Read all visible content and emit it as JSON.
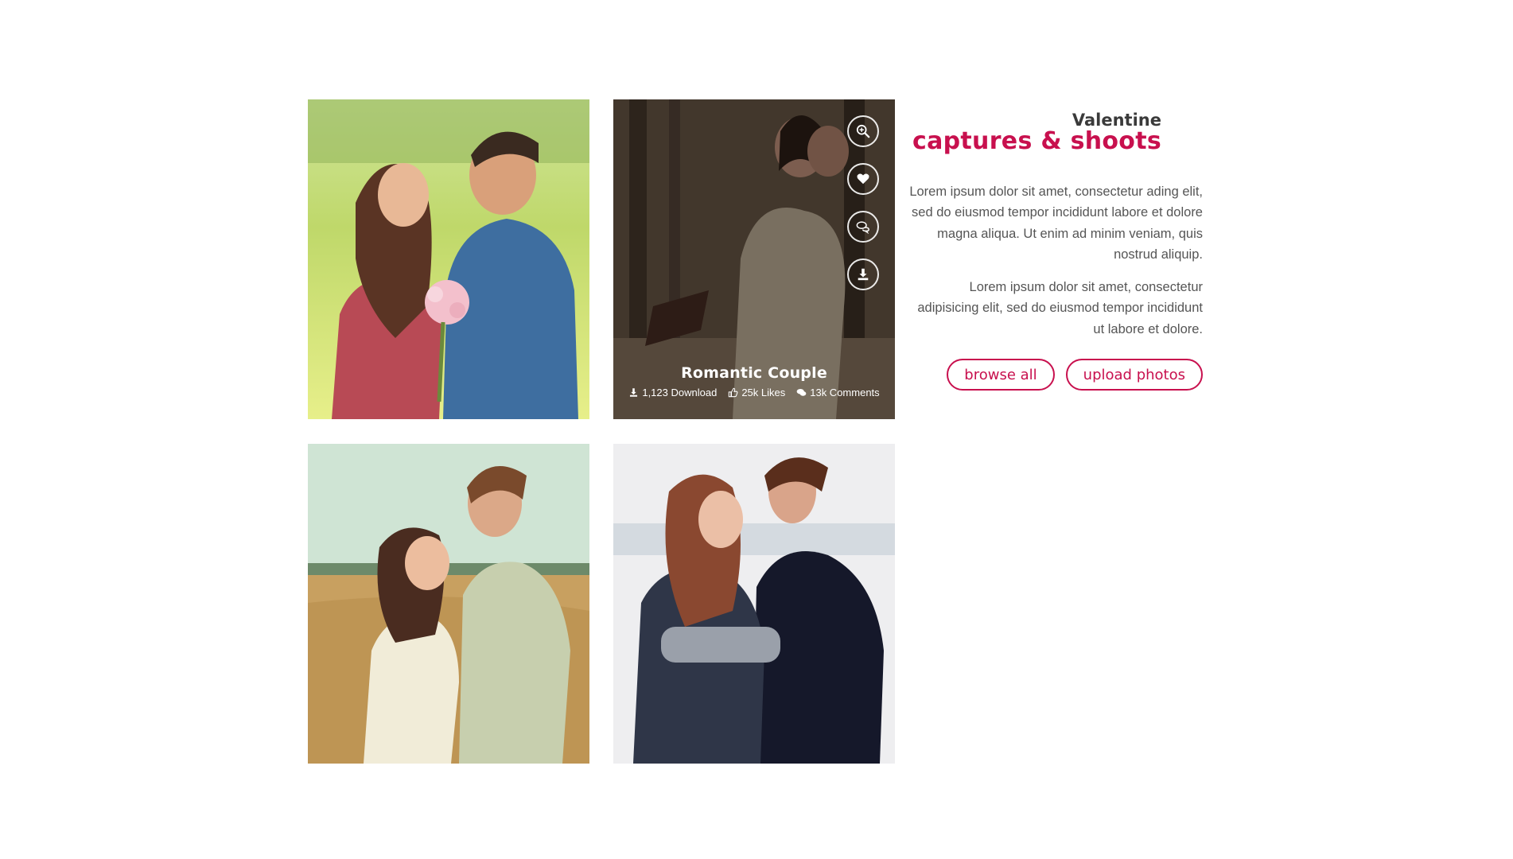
{
  "gallery": {
    "photos": [
      {
        "id": "p1",
        "alt": "couple-in-sunny-field"
      },
      {
        "id": "p2",
        "alt": "couple-embracing-in-forest",
        "title": "Romantic Couple",
        "stats": {
          "downloads": "1,123 Download",
          "likes": "25k Likes",
          "comments": "13k Comments"
        }
      },
      {
        "id": "p3",
        "alt": "couple-in-wheat-field"
      },
      {
        "id": "p4",
        "alt": "couple-in-snow"
      }
    ],
    "actions": [
      "zoom-icon",
      "heart-icon",
      "comments-icon",
      "download-icon"
    ]
  },
  "info": {
    "kicker": "Valentine",
    "headline": "captures & shoots",
    "paragraph1": "Lorem ipsum dolor sit amet, consectetur ading elit, sed do eiusmod tempor incididunt labore et dolore magna aliqua. Ut enim ad minim veniam, quis nostrud aliquip.",
    "paragraph2": "Lorem ipsum dolor sit amet, consectetur adipisicing elit, sed do eiusmod tempor incididunt ut labore et dolore.",
    "browse_label": "browse all",
    "upload_label": "upload photos"
  },
  "colors": {
    "accent": "#c8104e",
    "heading": "#3a3a3a",
    "body_text": "#555555"
  }
}
